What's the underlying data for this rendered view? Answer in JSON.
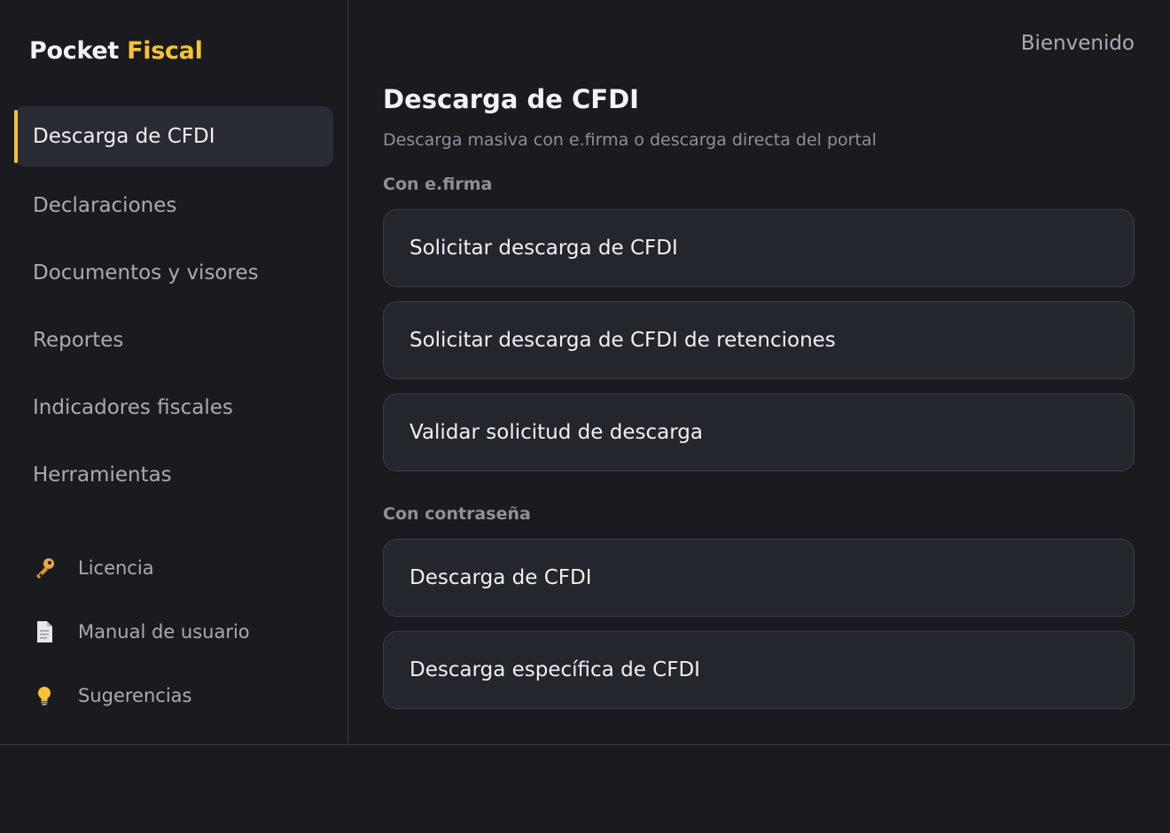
{
  "brand": {
    "word1": "Pocket",
    "word2": "Fiscal"
  },
  "sidebar": {
    "items": [
      {
        "label": "Descarga de CFDI",
        "active": true
      },
      {
        "label": "Declaraciones"
      },
      {
        "label": "Documentos y visores"
      },
      {
        "label": "Reportes"
      },
      {
        "label": "Indicadores fiscales"
      },
      {
        "label": "Herramientas"
      }
    ],
    "footer": [
      {
        "label": "Licencia",
        "icon": "key-icon"
      },
      {
        "label": "Manual de usuario",
        "icon": "document-icon"
      },
      {
        "label": "Sugerencias",
        "icon": "lightbulb-icon"
      }
    ]
  },
  "header": {
    "welcome": "Bienvenido"
  },
  "main": {
    "title": "Descarga de CFDI",
    "subtitle": "Descarga masiva con e.firma o descarga directa del portal",
    "sections": [
      {
        "label": "Con e.firma",
        "actions": [
          "Solicitar descarga de CFDI",
          "Solicitar descarga de CFDI de retenciones",
          "Validar solicitud de descarga"
        ]
      },
      {
        "label": "Con contraseña",
        "actions": [
          "Descarga de CFDI",
          "Descarga específica de CFDI"
        ]
      }
    ]
  },
  "colors": {
    "accent": "#f7c234",
    "background": "#1a1b1f",
    "card": "#24262d"
  }
}
